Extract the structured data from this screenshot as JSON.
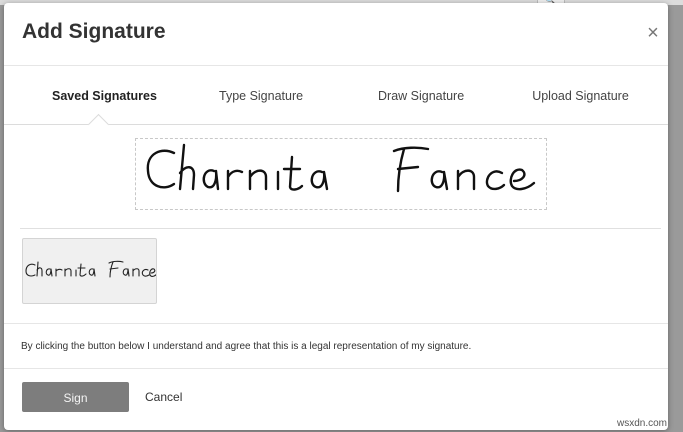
{
  "background": {
    "search_icon": "search-icon"
  },
  "dialog": {
    "title": "Add Signature",
    "close_icon": "close-icon",
    "close_glyph": "×"
  },
  "tabs": [
    {
      "label": "Saved Signatures",
      "active": true
    },
    {
      "label": "Type Signature",
      "active": false
    },
    {
      "label": "Draw Signature",
      "active": false
    },
    {
      "label": "Upload Signature",
      "active": false
    }
  ],
  "signature": {
    "preview_text": "Charnita Fance",
    "saved_items": [
      {
        "text": "Charnita Fance"
      }
    ]
  },
  "legal": {
    "text": "By clicking the button below I understand and agree that this is a legal representation of my signature."
  },
  "footer": {
    "sign_label": "Sign",
    "cancel_label": "Cancel"
  },
  "watermark": "wsxdn.com",
  "colors": {
    "sign_button": "#7d7d7d",
    "overlay": "#9a9a9a"
  }
}
